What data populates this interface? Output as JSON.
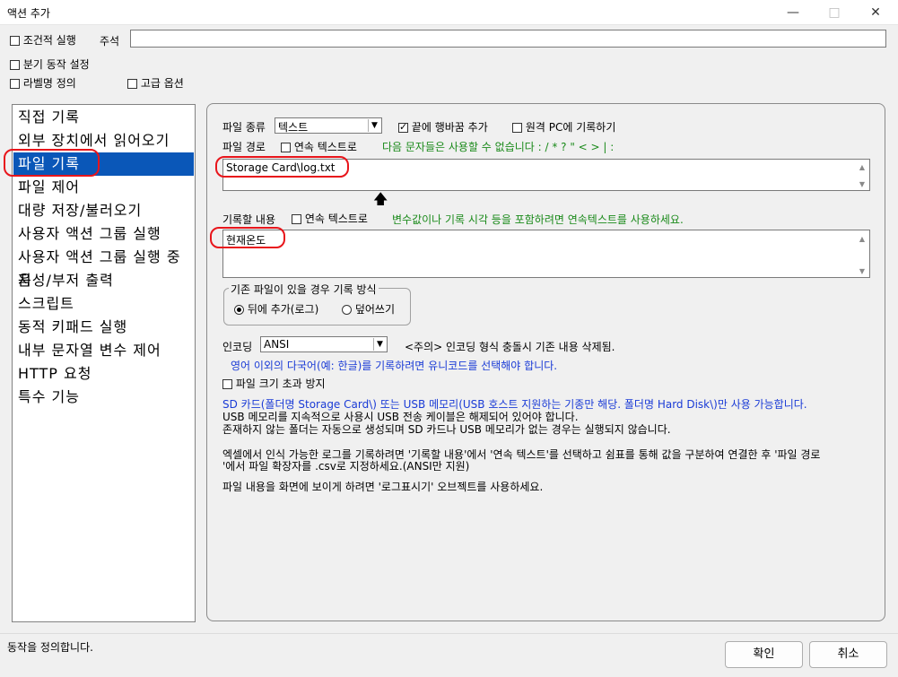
{
  "window": {
    "title": "액션 추가",
    "minimize_icon": "minimize-icon",
    "maximize_icon": "maximize-icon",
    "close_icon": "close-icon"
  },
  "top_options": {
    "conditional_run": "조건적 실행",
    "comment_label": "주석",
    "comment_value": "",
    "branch_setting": "분기 동작 설정",
    "label_define": "라벨명 정의",
    "advanced_options": "고급 옵션"
  },
  "sidebar": {
    "items": [
      {
        "label": "직접 기록"
      },
      {
        "label": "외부 장치에서 읽어오기"
      },
      {
        "label": "파일 기록"
      },
      {
        "label": "파일 제어"
      },
      {
        "label": "대량 저장/불러오기"
      },
      {
        "label": "사용자 액션 그룹 실행"
      },
      {
        "label": "사용자 액션 그룹 실행 중지"
      },
      {
        "label": "음성/부저 출력"
      },
      {
        "label": "스크립트"
      },
      {
        "label": "동적 키패드 실행"
      },
      {
        "label": "내부 문자열 변수 제어"
      },
      {
        "label": "HTTP 요청"
      },
      {
        "label": "특수 기능"
      }
    ],
    "selected_index": 2
  },
  "panel": {
    "file_type_label": "파일 종류",
    "file_type_value": "텍스트",
    "append_newline_label": "끝에 행바꿈 추가",
    "append_newline_checked": true,
    "remote_pc_label": "원격 PC에 기록하기",
    "file_path_label": "파일 경로",
    "path_continuous_label": "연속 텍스트로",
    "forbidden_chars_note": "다음 문자들은 사용할 수 없습니다 :  / * ? \" < > | :",
    "file_path_value": "Storage Card\\log.txt",
    "content_label": "기록할 내용",
    "content_continuous_label": "연속 텍스트로",
    "content_note": "변수값이나 기록 시각 등을 포함하려면 연속텍스트를 사용하세요.",
    "content_value": "현재온도",
    "existing_file_group": "기존 파일이 있을 경우 기록 방식",
    "append_log_label": "뒤에 추가(로그)",
    "overwrite_label": "덮어쓰기",
    "encoding_label": "인코딩",
    "encoding_value": "ANSI",
    "encoding_warning": "<주의> 인코딩 형식 충돌시 기존 내용 삭제됨.",
    "unicode_note": "영어 이외의 다국어(예: 한글)를 기록하려면 유니코드를 선택해야 합니다.",
    "size_limit_label": "파일 크기 초과 방지",
    "sd_note": "SD 카드(폴더명 Storage Card\\) 또는 USB 메모리(USB 호스트 지원하는 기종만 해당. 폴더명 Hard Disk\\)만 사용 가능합니다.",
    "usb_note": "USB 메모리를 지속적으로 사용시 USB 전송 케이블은 해제되어 있어야 합니다.",
    "folder_note": "존재하지 않는 폴더는 자동으로 생성되며 SD 카드나 USB 메모리가 없는 경우는 실행되지 않습니다.",
    "excel_note_1": "엑셀에서 인식 가능한 로그를 기록하려면 '기록할 내용'에서 '연속 텍스트'를 선택하고 쉼표를 통해 값을 구분하여 연결한 후 '파일 경로",
    "excel_note_2": "'에서 파일 확장자를 .csv로 지정하세요.(ANSI만 지원)",
    "log_display_note": "파일 내용을 화면에 보이게 하려면 '로그표시기' 오브젝트를 사용하세요."
  },
  "footer": {
    "status": "동작을 정의합니다.",
    "ok": "확인",
    "cancel": "취소"
  },
  "colors": {
    "selected": "#0a57b8",
    "highlight_circle": "#e8151b",
    "note_green": "#1a8a1a",
    "note_blue": "#1a3bd6"
  }
}
